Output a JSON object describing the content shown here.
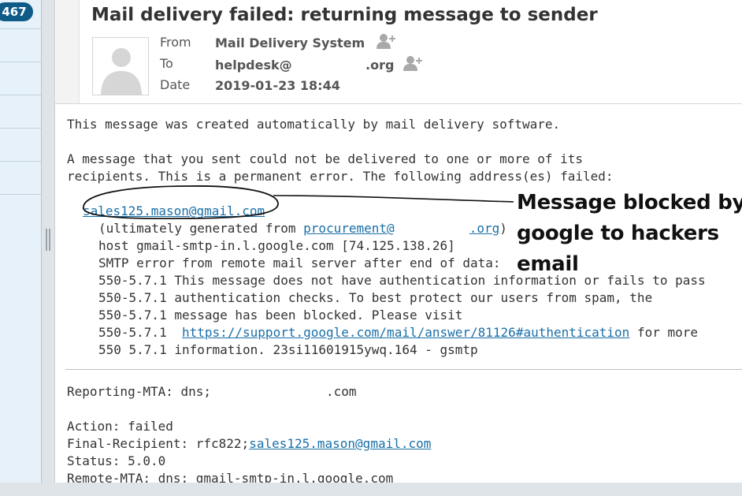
{
  "folder_pane": {
    "unread_count": "467"
  },
  "message": {
    "subject": "Mail delivery failed: returning message to sender",
    "from_label": "From",
    "from_value": "Mail Delivery System",
    "to_label": "To",
    "to_value_user": "helpdesk@",
    "to_value_domain": ".org",
    "date_label": "Date",
    "date_value": "2019-01-23 18:44"
  },
  "body": {
    "line_intro": "This message was created automatically by mail delivery software.",
    "line_msg1": "A message that you sent could not be delivered to one or more of its",
    "line_msg2": "recipients. This is a permanent error. The following address(es) failed:",
    "failed_address": "sales125.mason@gmail.com",
    "ultimately_prefix": "(ultimately generated from ",
    "procurement_user": "procurement@",
    "procurement_domain": ".org",
    "ultimately_suffix": ")",
    "host_line": "host gmail-smtp-in.l.google.com [74.125.138.26]",
    "smtp_line": "SMTP error from remote mail server after end of data:",
    "err1": "550-5.7.1 This message does not have authentication information or fails to pass",
    "err2": "550-5.7.1 authentication checks. To best protect our users from spam, the",
    "err3": "550-5.7.1 message has been blocked. Please visit",
    "err4_prefix": "550-5.7.1  ",
    "err4_link": "https://support.google.com/mail/answer/81126#authentication",
    "err4_suffix": " for more",
    "err5": "550 5.7.1 information. 23si11601915ywq.164 - gsmtp",
    "reporting_mta_prefix": "Reporting-MTA: dns;",
    "reporting_mta_domain": ".com",
    "action": "Action: failed",
    "final_recipient_prefix": "Final-Recipient: rfc822;",
    "final_recipient_link": "sales125.mason@gmail.com",
    "status": "Status: 5.0.0",
    "remote_mta": "Remote-MTA: dns; gmail-smtp-in.l.google.com"
  },
  "annotation": {
    "line1": "Message blocked by",
    "line2": "google to hackers",
    "line3": "email"
  },
  "colors": {
    "badge": "#0f5b87",
    "link": "#1a6fa8",
    "annotation_ink": "#111111"
  }
}
